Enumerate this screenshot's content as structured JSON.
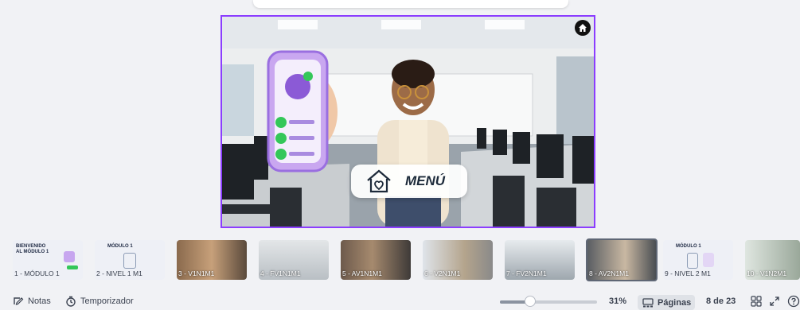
{
  "slide": {
    "menu_label": "MENÚ"
  },
  "thumbnails": [
    {
      "caption": "1 - MÓDULO 1",
      "title": "BIENVENIDO\nAL MÓDULO 1",
      "style": "title"
    },
    {
      "caption": "2 - NIVEL 1 M1",
      "title": "MÓDULO 1",
      "style": "title"
    },
    {
      "caption": "3 - V1N1M1",
      "style": "photo"
    },
    {
      "caption": "4 - FV1N1M1",
      "style": "photo"
    },
    {
      "caption": "5 - AV1N1M1",
      "style": "photo"
    },
    {
      "caption": "6 - V2N1M1",
      "style": "photo"
    },
    {
      "caption": "7 - FV2N1M1",
      "style": "photo"
    },
    {
      "caption": "8 - AV2N1M1",
      "style": "photo"
    },
    {
      "caption": "9 - NIVEL 2 M1",
      "title": "MÓDULO 1",
      "style": "title"
    },
    {
      "caption": "10 - V1N2M1",
      "style": "photo"
    }
  ],
  "bottom": {
    "notes_label": "Notas",
    "timer_label": "Temporizador",
    "zoom": "31%",
    "zoom_value": 0.31,
    "pages_label": "Páginas",
    "page_indicator": "8 de 23"
  },
  "colors": {
    "accent": "#8b3dff",
    "background": "#f1f2f5"
  }
}
